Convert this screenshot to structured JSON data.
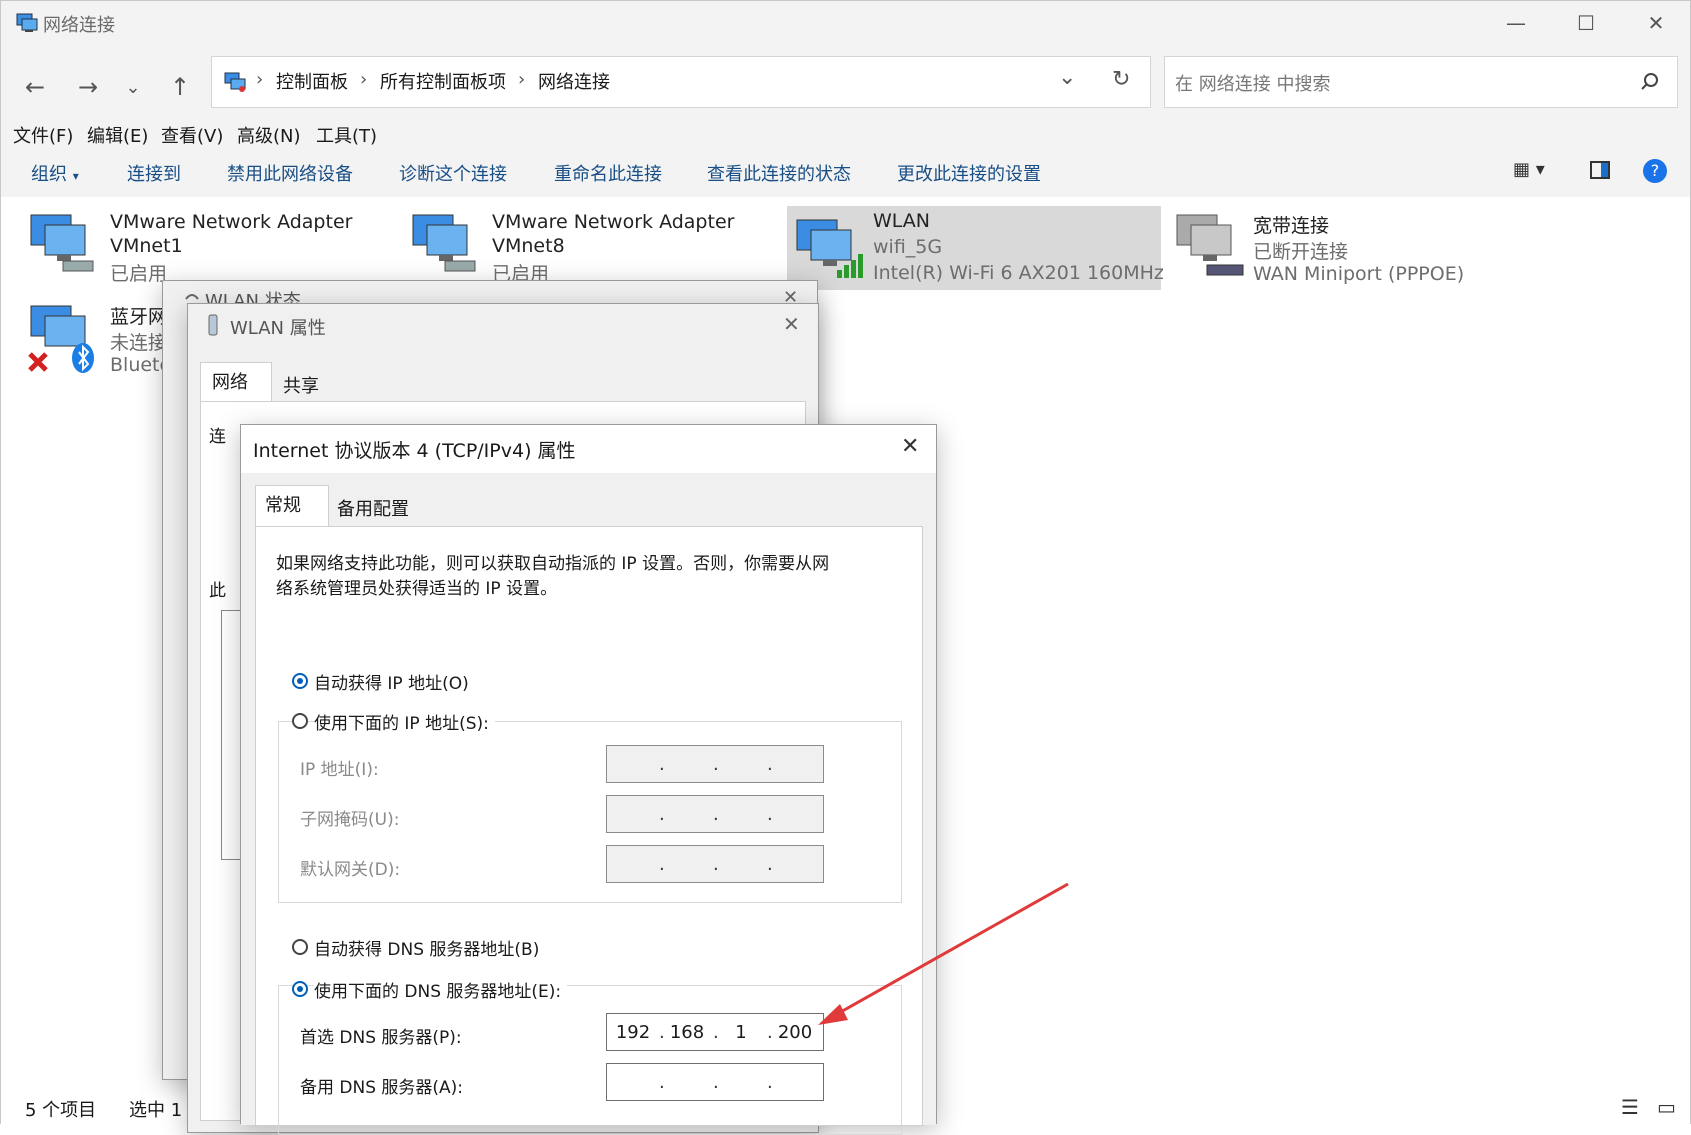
{
  "window": {
    "title": "网络连接"
  },
  "titlebar": {
    "minimize": "—",
    "maximize": "☐",
    "close": "✕"
  },
  "address": {
    "crumbs": [
      "控制面板",
      "所有控制面板项",
      "网络连接"
    ],
    "sep": "›"
  },
  "search": {
    "placeholder": "在 网络连接 中搜索"
  },
  "menu": [
    "文件(F)",
    "编辑(E)",
    "查看(V)",
    "高级(N)",
    "工具(T)"
  ],
  "commands": [
    "组织",
    "连接到",
    "禁用此网络设备",
    "诊断这个连接",
    "重命名此连接",
    "查看此连接的状态",
    "更改此连接的设置"
  ],
  "connections": [
    {
      "name": "VMware Network Adapter",
      "name2": "VMnet1",
      "status": "已启用"
    },
    {
      "name": "VMware Network Adapter",
      "name2": "VMnet8",
      "status": "已启用"
    },
    {
      "name": "WLAN",
      "status": "wifi_5G",
      "device": "Intel(R) Wi-Fi 6 AX201 160MHz"
    },
    {
      "name": "宽带连接",
      "status": "已断开连接",
      "device": "WAN Miniport (PPPOE)"
    },
    {
      "name": "蓝牙网",
      "status": "未连接",
      "device": "Blueto"
    }
  ],
  "statusbar": {
    "count": "5 个项目",
    "selected": "选中 1"
  },
  "wlan_status": {
    "title": "WLAN 状态"
  },
  "wlan_props": {
    "title": "WLAN 属性",
    "tabs": [
      "网络",
      "共享"
    ],
    "connect_label": "连",
    "this_label": "此"
  },
  "ipv4": {
    "title": "Internet 协议版本 4 (TCP/IPv4) 属性",
    "tabs": [
      "常规",
      "备用配置"
    ],
    "description_line1": "如果网络支持此功能，则可以获取自动指派的 IP 设置。否则，你需要从网",
    "description_line2": "络系统管理员处获得适当的 IP 设置。",
    "auto_ip": "自动获得 IP 地址(O)",
    "manual_ip": "使用下面的 IP 地址(S):",
    "ip_label": "IP 地址(I):",
    "mask_label": "子网掩码(U):",
    "gateway_label": "默认网关(D):",
    "auto_dns": "自动获得 DNS 服务器地址(B)",
    "manual_dns": "使用下面的 DNS 服务器地址(E):",
    "preferred_dns_label": "首选 DNS 服务器(P):",
    "alternate_dns_label": "备用 DNS 服务器(A):",
    "preferred_dns": [
      "192",
      "168",
      "1",
      "200"
    ],
    "selected": {
      "ip_mode": "auto",
      "dns_mode": "manual"
    }
  },
  "colors": {
    "accent": "#005fb8",
    "arrow": "#e03a3a",
    "selection": "#d9d9d9"
  }
}
